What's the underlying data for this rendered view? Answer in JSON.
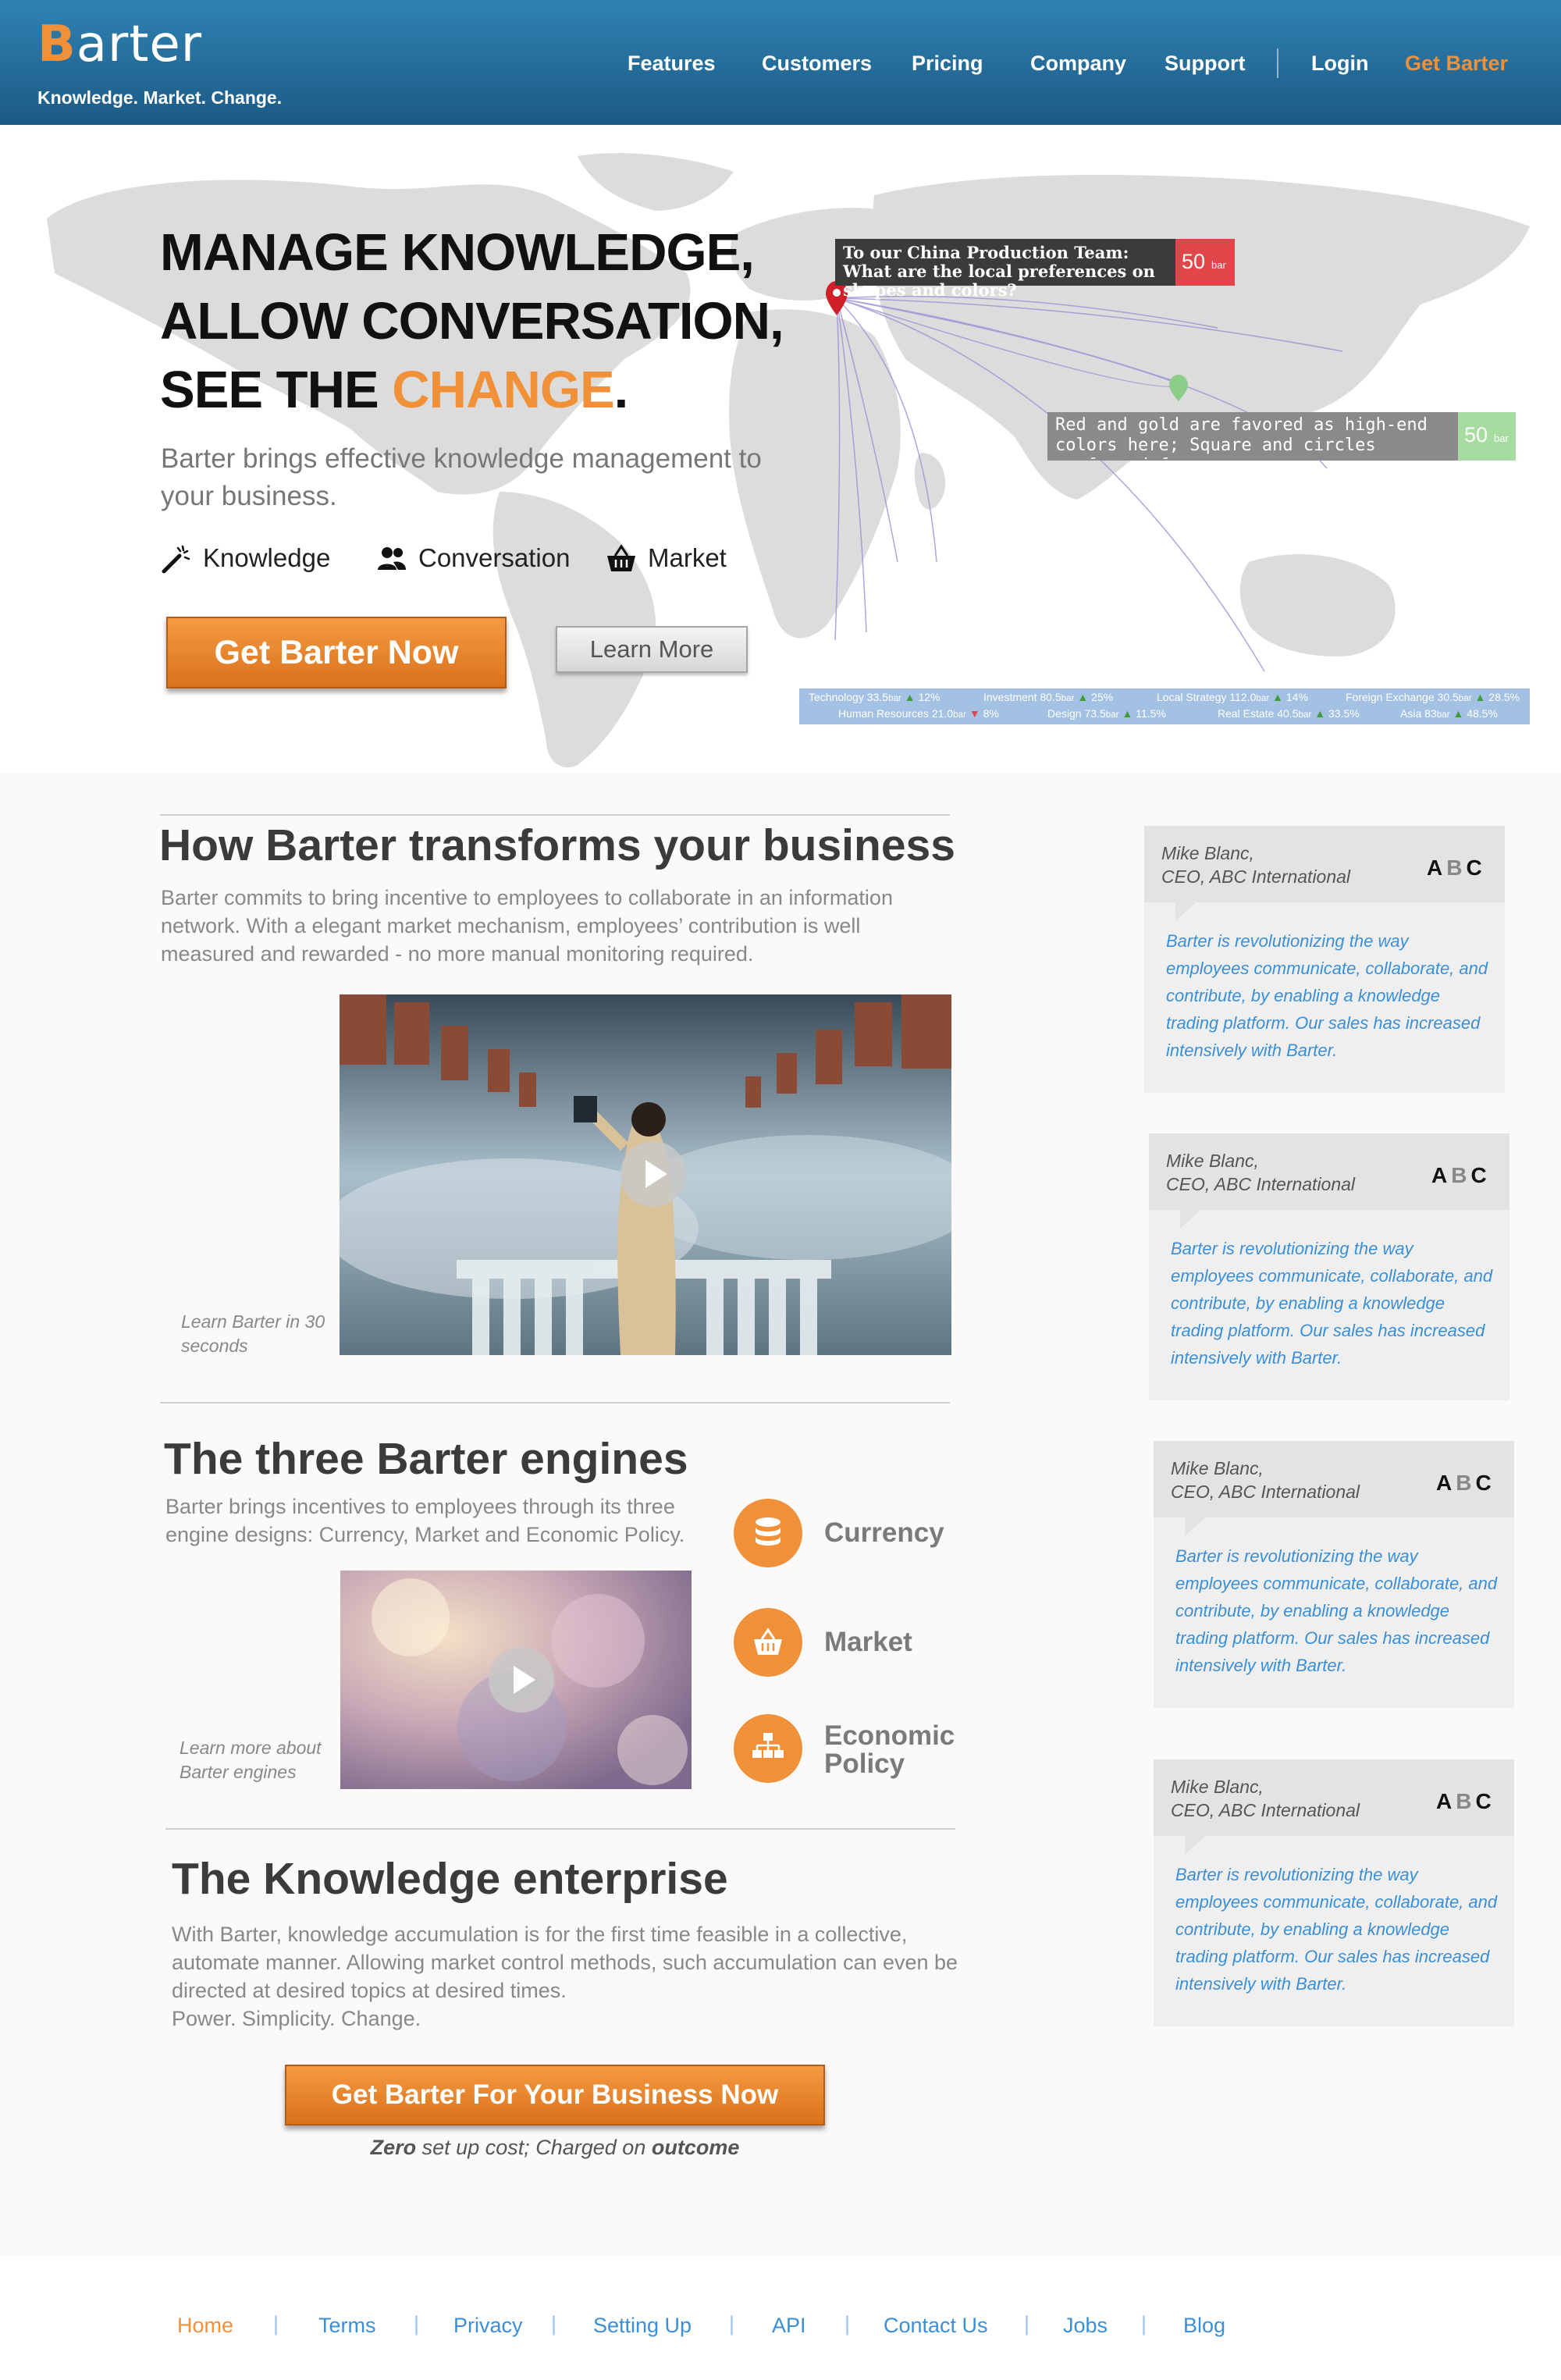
{
  "header": {
    "logo_letter": "B",
    "logo_rest": "arter",
    "tagline": "Knowledge. Market. Change.",
    "nav": [
      "Features",
      "Customers",
      "Pricing",
      "Company",
      "Support"
    ],
    "login": "Login",
    "cta": "Get Barter"
  },
  "hero": {
    "title_line1": "MANAGE KNOWLEDGE,",
    "title_line2": "ALLOW CONVERSATION,",
    "title_line3_prefix": "SEE THE ",
    "title_line3_accent": "CHANGE",
    "title_line3_suffix": ".",
    "subtitle": "Barter brings effective knowledge management to your business.",
    "features": [
      "Knowledge",
      "Conversation",
      "Market"
    ],
    "primary_button": "Get Barter Now",
    "secondary_button": "Learn More",
    "question_bubble": {
      "text": "To our China Production Team: What are the local preferences on shapes and colors?",
      "value": "50",
      "unit": "bar"
    },
    "answer_bubble": {
      "text": "Red and gold are favored as high-end colors here; Square and circles preferred for ...",
      "value": "50",
      "unit": "bar"
    },
    "ticker": [
      {
        "label": "Technology",
        "value": "33.5",
        "unit": "bar",
        "dir": "up",
        "change": "12%"
      },
      {
        "label": "Investment",
        "value": "80.5",
        "unit": "bar",
        "dir": "up",
        "change": "25%"
      },
      {
        "label": "Local Strategy",
        "value": "112.0",
        "unit": "bar",
        "dir": "up",
        "change": "14%"
      },
      {
        "label": "Foreign Exchange",
        "value": "30.5",
        "unit": "bar",
        "dir": "up",
        "change": "28.5%"
      },
      {
        "label": "Human Resources",
        "value": "21.0",
        "unit": "bar",
        "dir": "down",
        "change": "8%"
      },
      {
        "label": "Design",
        "value": "73.5",
        "unit": "bar",
        "dir": "up",
        "change": "11.5%"
      },
      {
        "label": "Real Estate",
        "value": "40.5",
        "unit": "bar",
        "dir": "up",
        "change": "33.5%"
      },
      {
        "label": "Asia",
        "value": "83",
        "unit": "bar",
        "dir": "up",
        "change": "48.5%"
      }
    ]
  },
  "sections": {
    "transforms": {
      "title": "How Barter transforms your business",
      "body": "Barter commits to bring incentive to employees to collaborate in an information network. With a elegant market mechanism, employees’ contribution is well measured and rewarded - no more manual monitoring required.",
      "video_caption": "Learn Barter in 30 seconds"
    },
    "engines": {
      "title": "The three Barter engines",
      "body": "Barter brings incentives to employees through its three engine designs: Currency, Market and Economic Policy.",
      "video_caption": "Learn more about Barter engines",
      "items": [
        "Currency",
        "Market",
        "Economic Policy"
      ]
    },
    "enterprise": {
      "title": "The Knowledge enterprise",
      "body": "With Barter, knowledge accumulation is for the first time feasible in a collective, automate manner. Allowing market control methods, such accumulation can even be directed at desired topics at desired times.",
      "tagline": "Power. Simplicity. Change.",
      "button": "Get Barter For Your Business Now",
      "note_zero": "Zero",
      "note_middle": " set up cost; Charged on ",
      "note_outcome": "outcome"
    }
  },
  "testimonials": [
    {
      "name": "Mike Blanc,",
      "title": "CEO, ABC International",
      "logo_a": "A",
      "logo_b": "B",
      "logo_c": "C",
      "quote": "Barter is revolutionizing the way employees communicate, collaborate, and contribute, by enabling a knowledge trading platform. Our sales has increased intensively with Barter."
    },
    {
      "name": "Mike Blanc,",
      "title": "CEO, ABC International",
      "logo_a": "A",
      "logo_b": "B",
      "logo_c": "C",
      "quote": "Barter is revolutionizing the way employees communicate, collaborate, and contribute, by enabling a knowledge trading platform. Our sales has increased intensively with Barter."
    },
    {
      "name": "Mike Blanc,",
      "title": "CEO, ABC International",
      "logo_a": "A",
      "logo_b": "B",
      "logo_c": "C",
      "quote": "Barter is revolutionizing the way employees communicate, collaborate, and contribute, by enabling a knowledge trading platform. Our sales has increased intensively with Barter."
    },
    {
      "name": "Mike Blanc,",
      "title": "CEO, ABC International",
      "logo_a": "A",
      "logo_b": "B",
      "logo_c": "C",
      "quote": "Barter is revolutionizing the way employees communicate, collaborate, and contribute, by enabling a knowledge trading platform. Our sales has increased intensively with Barter."
    }
  ],
  "footer": {
    "links": [
      "Home",
      "Terms",
      "Privacy",
      "Setting Up",
      "API",
      "Contact Us",
      "Jobs",
      "Blog"
    ],
    "separator": "|",
    "active_color": "#f0913a"
  },
  "colors": {
    "accent": "#f0913a",
    "header": "#1c5a85",
    "link": "#3a8fd6",
    "question_badge": "#e0464a",
    "answer_badge": "#a6dca0"
  }
}
